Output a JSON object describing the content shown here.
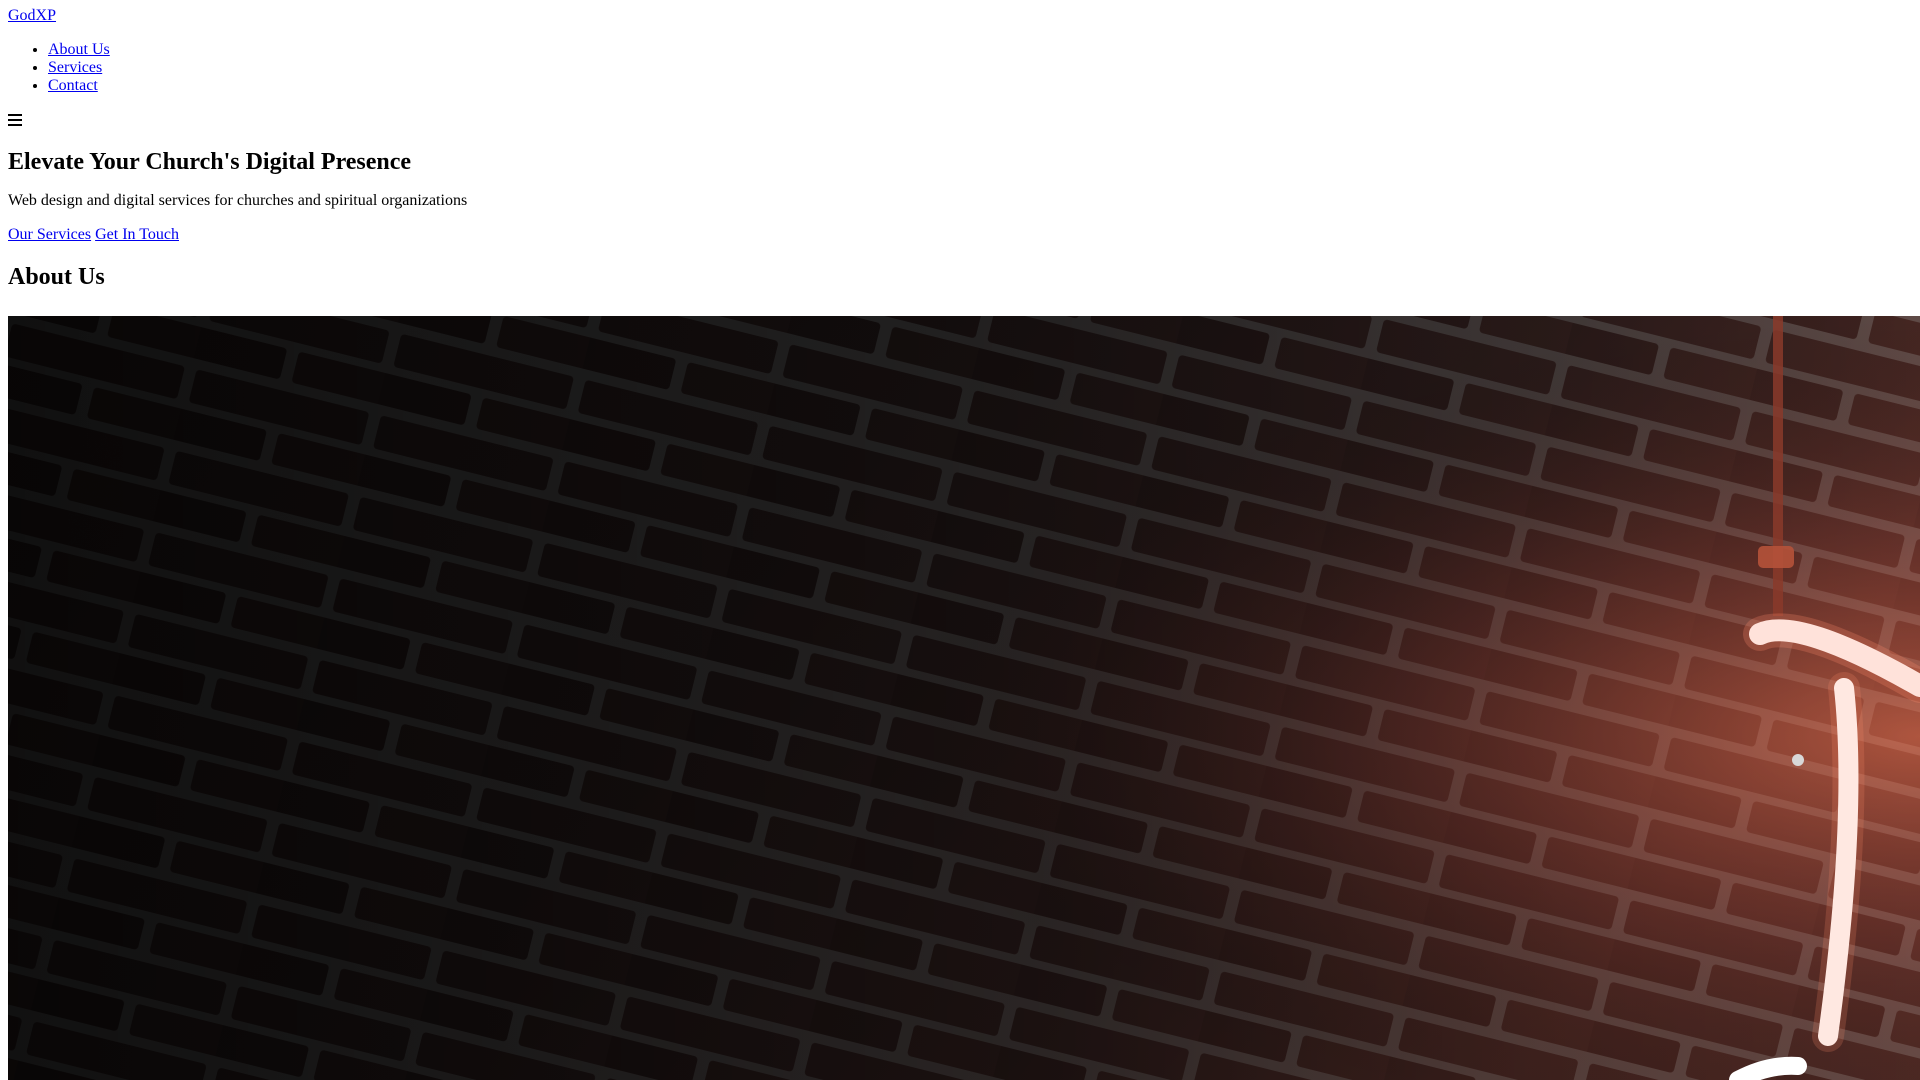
{
  "header": {
    "brand": "GodXP",
    "nav_items": [
      {
        "label": "About Us"
      },
      {
        "label": "Services"
      },
      {
        "label": "Contact"
      }
    ],
    "menu_icon": "hamburger-menu-icon"
  },
  "hero": {
    "title": "Elevate Your Church's Digital Presence",
    "subtitle": "Web design and digital services for churches and spiritual organizations",
    "cta_primary": "Our Services",
    "cta_secondary": "Get In Touch"
  },
  "about": {
    "heading": "About Us",
    "image": "dark-brick-wall-with-neon-light-photo"
  },
  "colors": {
    "link": "#0000ee",
    "text": "#000000",
    "background": "#ffffff"
  }
}
